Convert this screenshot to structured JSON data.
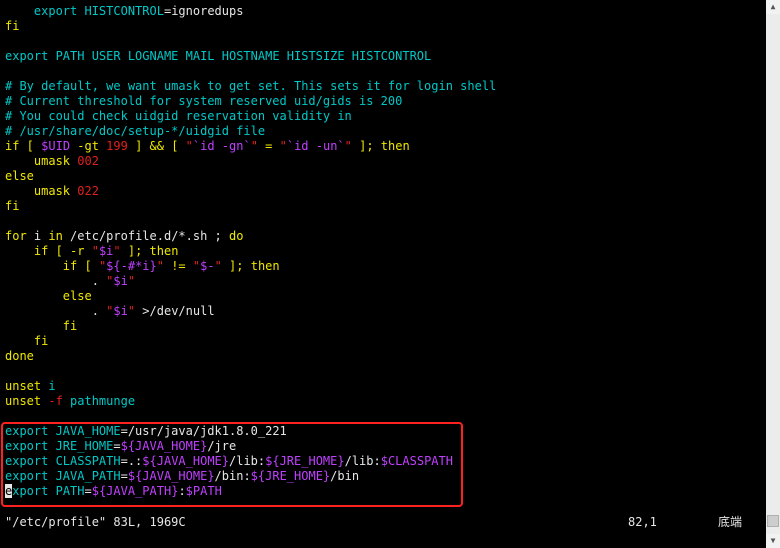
{
  "editor": {
    "lines": [
      [
        {
          "t": "    export ",
          "c": "cyan"
        },
        {
          "t": "HISTCONTROL",
          "c": "cyan"
        },
        {
          "t": "=ignoredups",
          "c": "default"
        }
      ],
      [
        {
          "t": "fi",
          "c": "yellow"
        }
      ],
      [
        {
          "t": "",
          "c": "default"
        }
      ],
      [
        {
          "t": "export ",
          "c": "cyan"
        },
        {
          "t": "PATH USER LOGNAME MAIL HOSTNAME HISTSIZE HISTCONTROL",
          "c": "cyan"
        }
      ],
      [
        {
          "t": "",
          "c": "default"
        }
      ],
      [
        {
          "t": "# By default, we want umask to get set. This sets it for login shell",
          "c": "comment"
        }
      ],
      [
        {
          "t": "# Current threshold for system reserved uid/gids is 200",
          "c": "comment"
        }
      ],
      [
        {
          "t": "# You could check uidgid reservation validity in",
          "c": "comment"
        }
      ],
      [
        {
          "t": "# /usr/share/doc/setup-*/uidgid file",
          "c": "comment"
        }
      ],
      [
        {
          "t": "if",
          "c": "yellow"
        },
        {
          "t": " [ ",
          "c": "yellow"
        },
        {
          "t": "$UID",
          "c": "purple"
        },
        {
          "t": " -gt ",
          "c": "yellow"
        },
        {
          "t": "199",
          "c": "red"
        },
        {
          "t": " ] && [ ",
          "c": "yellow"
        },
        {
          "t": "\"",
          "c": "red"
        },
        {
          "t": "`id -gn`",
          "c": "purple"
        },
        {
          "t": "\"",
          "c": "red"
        },
        {
          "t": " = ",
          "c": "yellow"
        },
        {
          "t": "\"",
          "c": "red"
        },
        {
          "t": "`id -un`",
          "c": "purple"
        },
        {
          "t": "\"",
          "c": "red"
        },
        {
          "t": " ]; ",
          "c": "yellow"
        },
        {
          "t": "then",
          "c": "yellow"
        }
      ],
      [
        {
          "t": "    umask ",
          "c": "yellow"
        },
        {
          "t": "002",
          "c": "red"
        }
      ],
      [
        {
          "t": "else",
          "c": "yellow"
        }
      ],
      [
        {
          "t": "    umask ",
          "c": "yellow"
        },
        {
          "t": "022",
          "c": "red"
        }
      ],
      [
        {
          "t": "fi",
          "c": "yellow"
        }
      ],
      [
        {
          "t": "",
          "c": "default"
        }
      ],
      [
        {
          "t": "for",
          "c": "yellow"
        },
        {
          "t": " i ",
          "c": "default"
        },
        {
          "t": "in",
          "c": "yellow"
        },
        {
          "t": " /etc/profile.d/*.sh ; ",
          "c": "default"
        },
        {
          "t": "do",
          "c": "yellow"
        }
      ],
      [
        {
          "t": "    if",
          "c": "yellow"
        },
        {
          "t": " [ -r ",
          "c": "yellow"
        },
        {
          "t": "\"",
          "c": "red"
        },
        {
          "t": "$i",
          "c": "purple"
        },
        {
          "t": "\"",
          "c": "red"
        },
        {
          "t": " ]; ",
          "c": "yellow"
        },
        {
          "t": "then",
          "c": "yellow"
        }
      ],
      [
        {
          "t": "        if",
          "c": "yellow"
        },
        {
          "t": " [ ",
          "c": "yellow"
        },
        {
          "t": "\"",
          "c": "red"
        },
        {
          "t": "${-#*i}",
          "c": "purple"
        },
        {
          "t": "\"",
          "c": "red"
        },
        {
          "t": " != ",
          "c": "yellow"
        },
        {
          "t": "\"",
          "c": "red"
        },
        {
          "t": "$-",
          "c": "purple"
        },
        {
          "t": "\"",
          "c": "red"
        },
        {
          "t": " ]; ",
          "c": "yellow"
        },
        {
          "t": "then",
          "c": "yellow"
        }
      ],
      [
        {
          "t": "            . ",
          "c": "default"
        },
        {
          "t": "\"",
          "c": "red"
        },
        {
          "t": "$i",
          "c": "purple"
        },
        {
          "t": "\"",
          "c": "red"
        }
      ],
      [
        {
          "t": "        else",
          "c": "yellow"
        }
      ],
      [
        {
          "t": "            . ",
          "c": "default"
        },
        {
          "t": "\"",
          "c": "red"
        },
        {
          "t": "$i",
          "c": "purple"
        },
        {
          "t": "\"",
          "c": "red"
        },
        {
          "t": " >/dev/null",
          "c": "default"
        }
      ],
      [
        {
          "t": "        fi",
          "c": "yellow"
        }
      ],
      [
        {
          "t": "    fi",
          "c": "yellow"
        }
      ],
      [
        {
          "t": "done",
          "c": "yellow"
        }
      ],
      [
        {
          "t": "",
          "c": "default"
        }
      ],
      [
        {
          "t": "unset ",
          "c": "yellow"
        },
        {
          "t": "i",
          "c": "cyan"
        }
      ],
      [
        {
          "t": "unset ",
          "c": "yellow"
        },
        {
          "t": "-f",
          "c": "red"
        },
        {
          "t": " pathmunge",
          "c": "cyan"
        }
      ],
      [
        {
          "t": "",
          "c": "default"
        }
      ],
      [
        {
          "t": "export ",
          "c": "cyan"
        },
        {
          "t": "JAVA_HOME",
          "c": "cyan"
        },
        {
          "t": "=/usr/java/jdk1.8.0_221",
          "c": "default"
        }
      ],
      [
        {
          "t": "export ",
          "c": "cyan"
        },
        {
          "t": "JRE_HOME",
          "c": "cyan"
        },
        {
          "t": "=",
          "c": "default"
        },
        {
          "t": "${JAVA_HOME}",
          "c": "purple"
        },
        {
          "t": "/jre",
          "c": "default"
        }
      ],
      [
        {
          "t": "export ",
          "c": "cyan"
        },
        {
          "t": "CLASSPATH",
          "c": "cyan"
        },
        {
          "t": "=.:",
          "c": "default"
        },
        {
          "t": "${JAVA_HOME}",
          "c": "purple"
        },
        {
          "t": "/lib:",
          "c": "default"
        },
        {
          "t": "${JRE_HOME}",
          "c": "purple"
        },
        {
          "t": "/lib:",
          "c": "default"
        },
        {
          "t": "$CLASSPATH",
          "c": "purple"
        }
      ],
      [
        {
          "t": "export ",
          "c": "cyan"
        },
        {
          "t": "JAVA_PATH",
          "c": "cyan"
        },
        {
          "t": "=",
          "c": "default"
        },
        {
          "t": "${JAVA_HOME}",
          "c": "purple"
        },
        {
          "t": "/bin:",
          "c": "default"
        },
        {
          "t": "${JRE_HOME}",
          "c": "purple"
        },
        {
          "t": "/bin",
          "c": "default"
        }
      ],
      [
        {
          "t": "e",
          "c": "cursor"
        },
        {
          "t": "xport ",
          "c": "cyan"
        },
        {
          "t": "PATH",
          "c": "cyan"
        },
        {
          "t": "=",
          "c": "default"
        },
        {
          "t": "${JAVA_PATH}",
          "c": "purple"
        },
        {
          "t": ":",
          "c": "default"
        },
        {
          "t": "$PATH",
          "c": "purple"
        }
      ]
    ]
  },
  "status": {
    "file_info": "\"/etc/profile\" 83L, 1969C",
    "cursor_position": "82,1",
    "scroll_position": "底端"
  },
  "colors": {
    "background": "#000000",
    "default": "#e6e6e6",
    "cyan": "#00c8c8",
    "purple": "#c040ff",
    "red": "#e02020",
    "yellow": "#f0e800",
    "highlight_box": "#ff2020"
  },
  "scrollbar": {
    "up_icon": "triangle-up",
    "down_icon": "triangle-down"
  }
}
